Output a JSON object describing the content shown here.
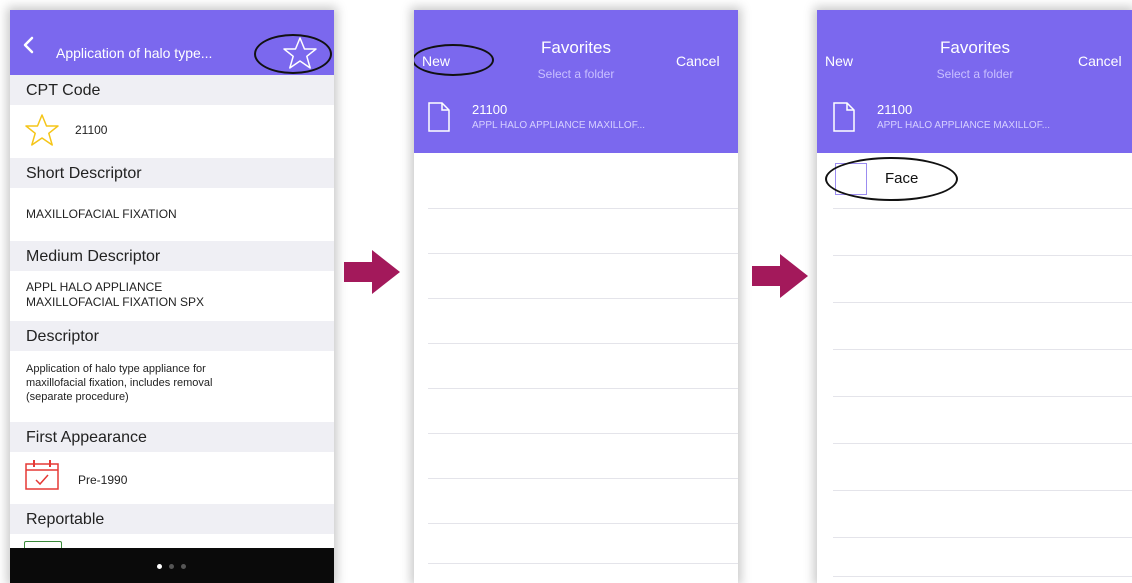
{
  "screen1": {
    "nav": {
      "back_icon": "chevron-left-icon",
      "title": "Application of halo type...",
      "star_icon": "star-outline-icon"
    },
    "cpt_code": {
      "header": "CPT Code",
      "value": "21100",
      "icon": "star-outline-icon"
    },
    "short_descriptor": {
      "header": "Short Descriptor",
      "value": "MAXILLOFACIAL FIXATION"
    },
    "medium_descriptor": {
      "header": "Medium Descriptor",
      "lines": [
        "APPL HALO APPLIANCE",
        "MAXILLOFACIAL FIXATION SPX"
      ]
    },
    "descriptor": {
      "header": "Descriptor",
      "lines": [
        "Application of halo type appliance for",
        "maxillofacial fixation, includes removal",
        "(separate procedure)"
      ]
    },
    "first_appearance": {
      "header": "First Appearance",
      "value": "Pre-1990",
      "icon": "calendar-icon"
    },
    "reportable": {
      "header": "Reportable"
    },
    "page_dots": 3,
    "active_page": 1
  },
  "screen2": {
    "nav": {
      "new_label": "New",
      "title": "Favorites",
      "subtitle": "Select a folder",
      "cancel_label": "Cancel"
    },
    "favorite": {
      "code": "21100",
      "description": "APPL HALO APPLIANCE MAXILLOF...",
      "icon": "document-icon"
    }
  },
  "screen3": {
    "nav": {
      "new_label": "New",
      "title": "Favorites",
      "subtitle": "Select a folder",
      "cancel_label": "Cancel"
    },
    "favorite": {
      "code": "21100",
      "description": "APPL HALO APPLIANCE MAXILLOF...",
      "icon": "document-icon"
    },
    "folder": {
      "name": "Face",
      "icon": "folder-icon"
    }
  },
  "colors": {
    "accent": "#7b68ee",
    "arrow": "#a3195b",
    "star": "#f5c518",
    "calendar": "#e53935",
    "section_bg": "#efeff4"
  }
}
